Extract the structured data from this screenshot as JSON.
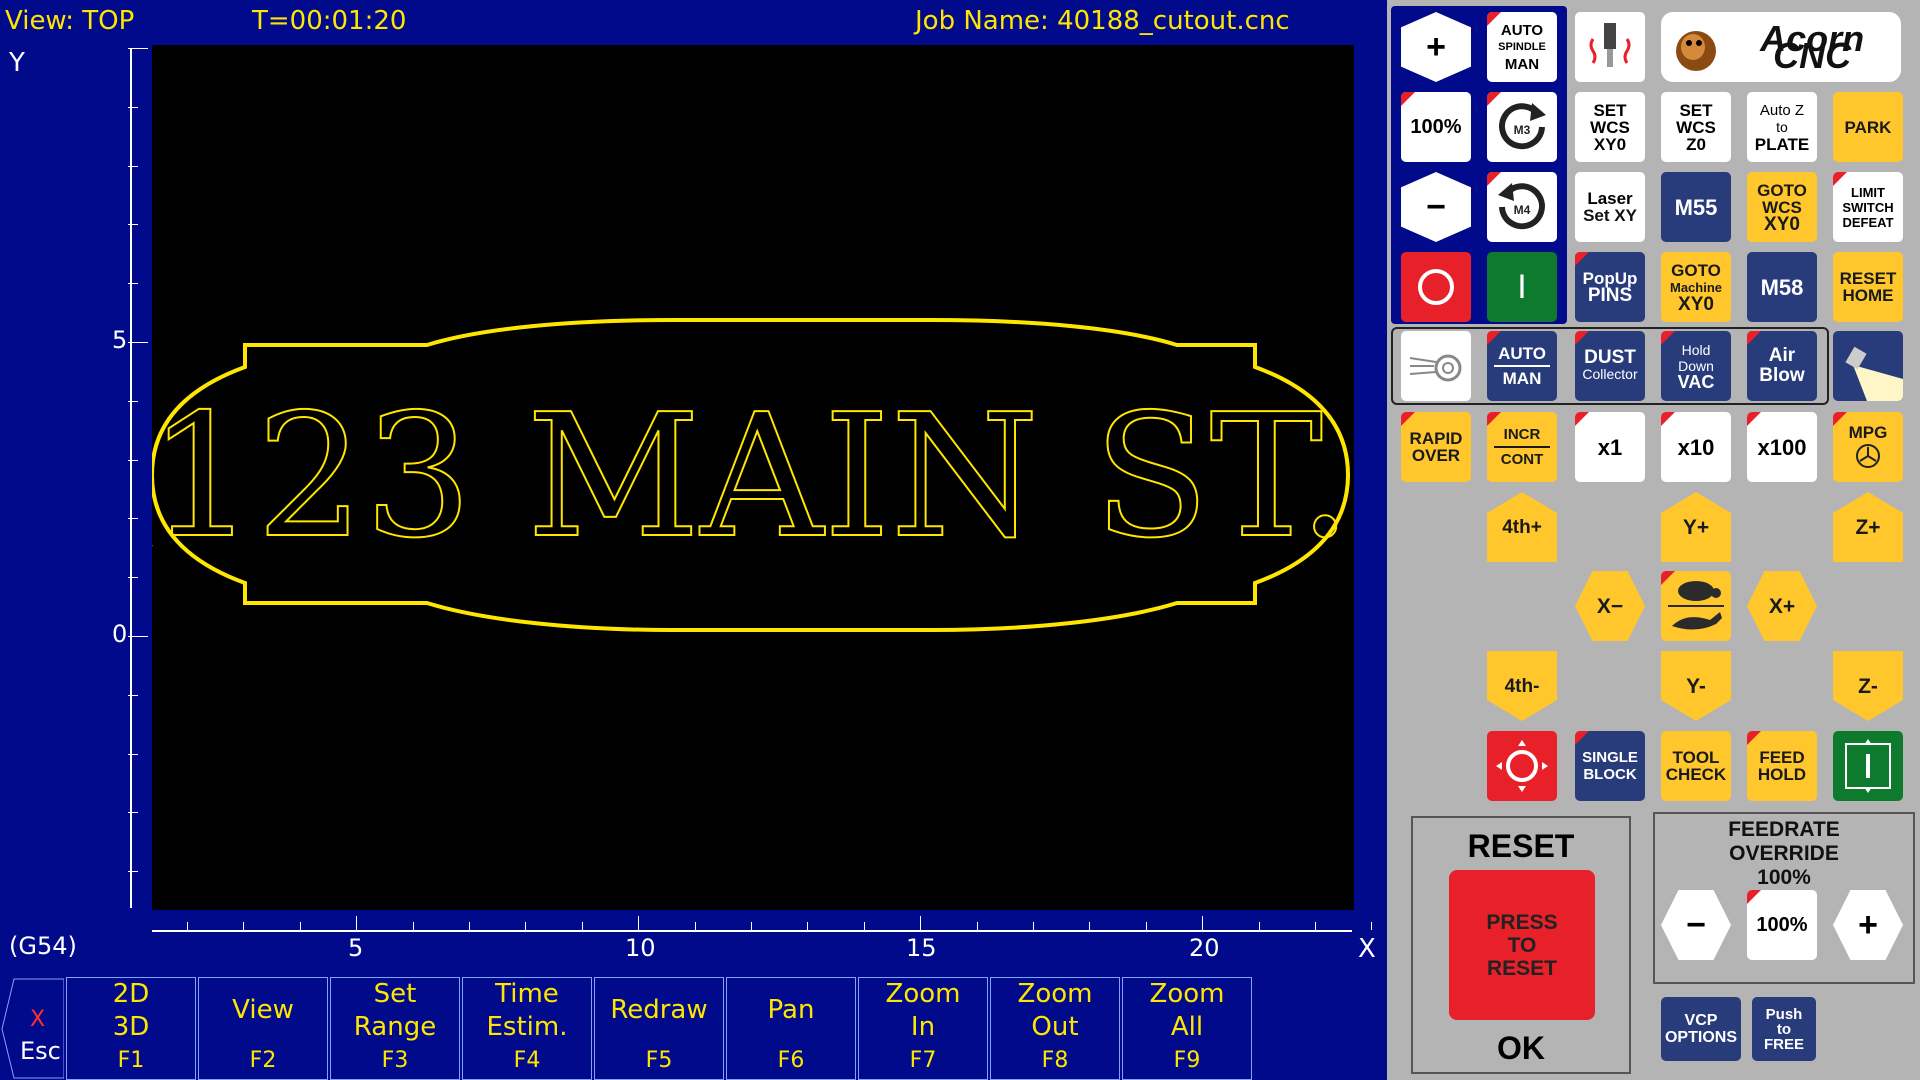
{
  "plot": {
    "view_label": "View: TOP",
    "time_label": "T=00:01:20",
    "job_label": "Job Name: 40188_cutout.cnc",
    "y_axis_label": "Y",
    "x_axis_label": "X",
    "wcs_label": "(G54)",
    "y_ticks": [
      "5",
      "0"
    ],
    "x_ticks": [
      "5",
      "10",
      "15",
      "20"
    ],
    "toolpath_text": "123 MAIN ST.",
    "colors": {
      "toolpath": "#ffe600",
      "background": "#000000",
      "panel": "#000a8a"
    }
  },
  "esc": {
    "x": "X",
    "label": "Esc"
  },
  "function_keys": [
    {
      "line1": "2D",
      "line2": "3D",
      "key": "F1"
    },
    {
      "line1": "View",
      "line2": "",
      "key": "F2"
    },
    {
      "line1": "Set",
      "line2": "Range",
      "key": "F3"
    },
    {
      "line1": "Time",
      "line2": "Estim.",
      "key": "F4"
    },
    {
      "line1": "Redraw",
      "line2": "",
      "key": "F5"
    },
    {
      "line1": "Pan",
      "line2": "",
      "key": "F6"
    },
    {
      "line1": "Zoom",
      "line2": "In",
      "key": "F7"
    },
    {
      "line1": "Zoom",
      "line2": "Out",
      "key": "F8"
    },
    {
      "line1": "Zoom",
      "line2": "All",
      "key": "F9"
    }
  ],
  "panel": {
    "logo": "Acorn CNC",
    "spindle": {
      "auto_l1": "AUTO",
      "auto_l2": "SPINDLE",
      "auto_l3": "MAN",
      "pct": "100%",
      "m3": "M3",
      "m4": "M4",
      "plus": "+",
      "minus": "−",
      "stop": "O",
      "start": "I"
    },
    "wcs": {
      "set_xy_l1": "SET",
      "set_xy_l2": "WCS",
      "set_xy_l3": "XY0",
      "set_z_l1": "SET",
      "set_z_l2": "WCS",
      "set_z_l3": "Z0",
      "autoz_l1": "Auto Z",
      "autoz_l2": "to",
      "autoz_l3": "PLATE",
      "park": "PARK"
    },
    "row3": {
      "laser_l1": "Laser",
      "laser_l2": "Set XY",
      "m55": "M55",
      "goto_l1": "GOTO",
      "goto_l2": "WCS",
      "goto_l3": "XY0",
      "limit_l1": "LIMIT",
      "limit_l2": "SWITCH",
      "limit_l3": "DEFEAT"
    },
    "row4": {
      "pins_l1": "PopUp",
      "pins_l2": "PINS",
      "gm_l1": "GOTO",
      "gm_l2": "Machine",
      "gm_l3": "XY0",
      "m58": "M58",
      "rh_l1": "RESET",
      "rh_l2": "HOME"
    },
    "coolant": {
      "auto": "AUTO",
      "man": "MAN",
      "dust_l1": "DUST",
      "dust_l2": "Collector",
      "vac_l1": "Hold",
      "vac_l2": "Down",
      "vac_l3": "VAC",
      "air_l1": "Air",
      "air_l2": "Blow"
    },
    "jog": {
      "rapid_l1": "RAPID",
      "rapid_l2": "OVER",
      "incr": "INCR",
      "cont": "CONT",
      "x1": "x1",
      "x10": "x10",
      "x100": "x100",
      "mpg": "MPG",
      "a_plus": "4th+",
      "y_plus": "Y+",
      "z_plus": "Z+",
      "x_minus": "X−",
      "x_plus": "X+",
      "a_minus": "4th-",
      "y_minus": "Y-",
      "z_minus": "Z-"
    },
    "row_bottom": {
      "single_l1": "SINGLE",
      "single_l2": "BLOCK",
      "tool_l1": "TOOL",
      "tool_l2": "CHECK",
      "feed_l1": "FEED",
      "feed_l2": "HOLD"
    },
    "reset": {
      "title": "RESET",
      "btn_l1": "PRESS",
      "btn_l2": "TO",
      "btn_l3": "RESET",
      "ok": "OK"
    },
    "feedrate": {
      "l1": "FEEDRATE",
      "l2": "OVERRIDE",
      "value": "100%",
      "minus": "−",
      "plus": "+",
      "pct": "100%"
    },
    "vcp_l1": "VCP",
    "vcp_l2": "OPTIONS",
    "push_l1": "Push",
    "push_l2": "to",
    "push_l3": "FREE"
  }
}
